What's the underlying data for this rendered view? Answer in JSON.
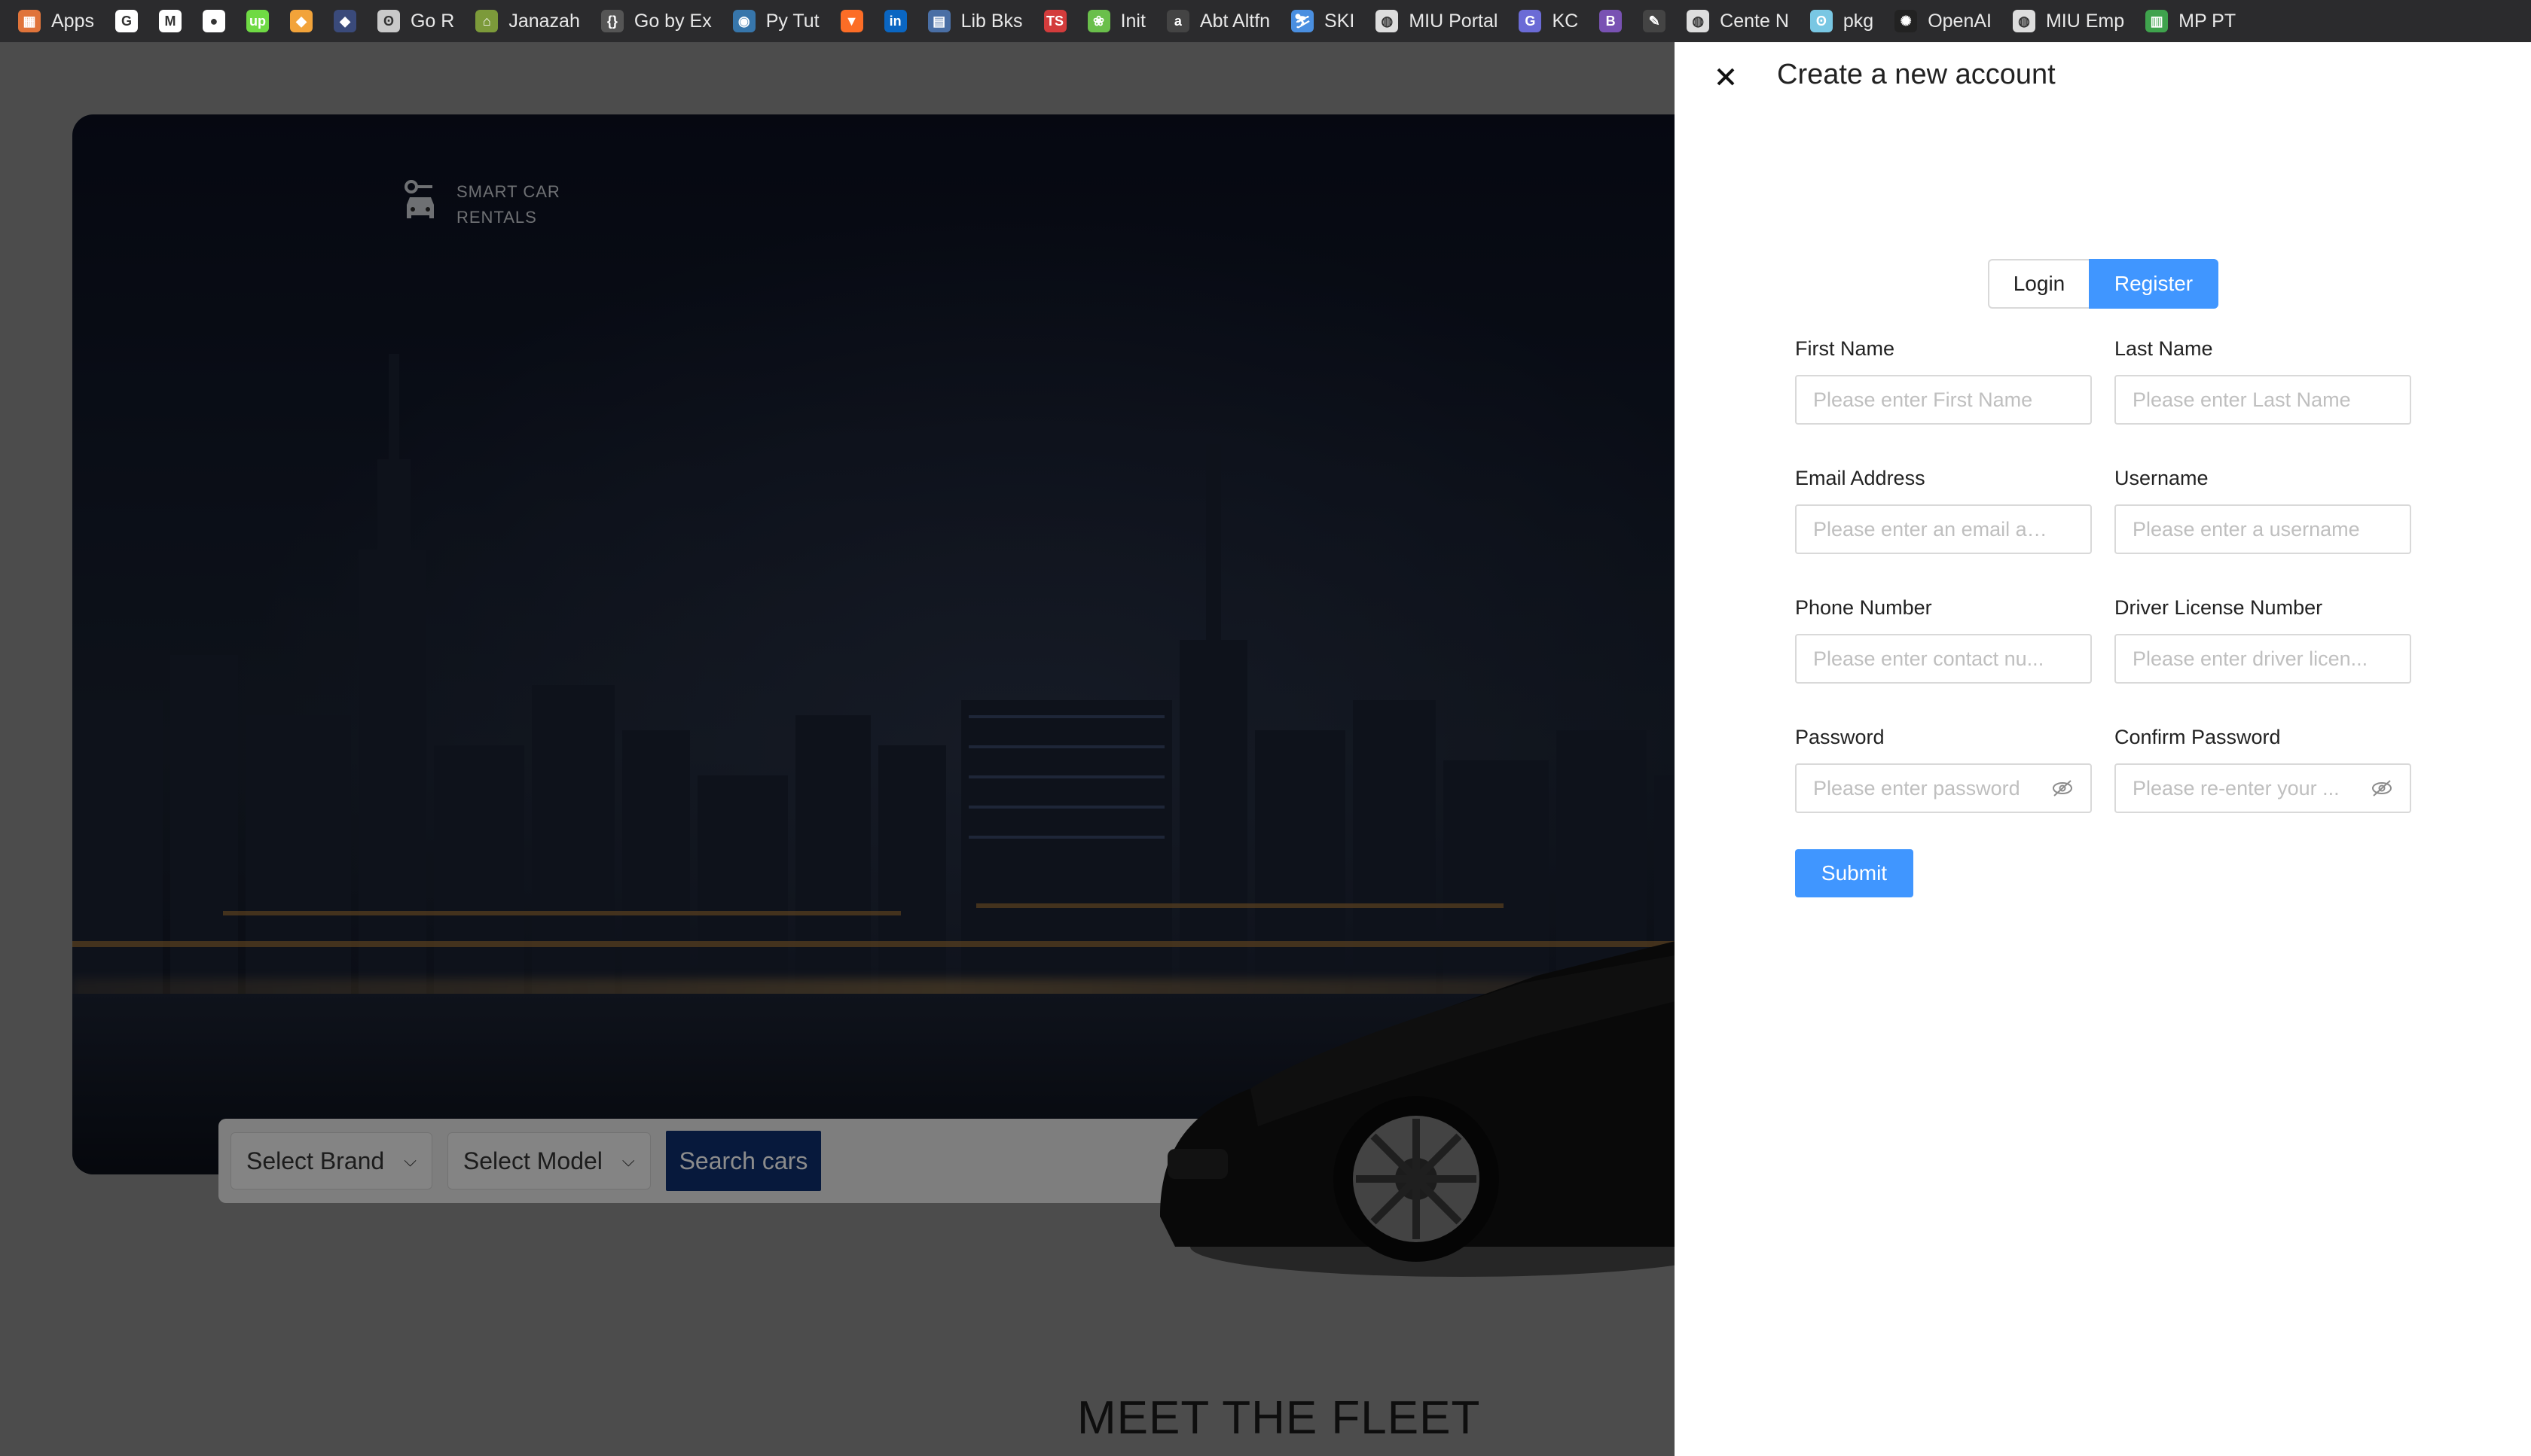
{
  "bookmarks": [
    {
      "label": "Apps",
      "icon": "apps-grid-icon",
      "color": "#e0743a"
    },
    {
      "label": "",
      "icon": "google-icon",
      "color": "#ffffff"
    },
    {
      "label": "",
      "icon": "gmail-icon",
      "color": "#ffffff"
    },
    {
      "label": "",
      "icon": "github-icon",
      "color": "#ffffff"
    },
    {
      "label": "",
      "icon": "upwork-icon",
      "color": "#6fda44"
    },
    {
      "label": "",
      "icon": "bookmark-icon",
      "color": "#f2a33a"
    },
    {
      "label": "",
      "icon": "bookmark-icon",
      "color": "#3a4a7a"
    },
    {
      "label": "Go R",
      "icon": "gopher-icon",
      "color": "#c9c9c9"
    },
    {
      "label": "Janazah",
      "icon": "mosque-icon",
      "color": "#7c9a3a"
    },
    {
      "label": "Go by Ex",
      "icon": "braces-icon",
      "color": "#555555"
    },
    {
      "label": "Py Tut",
      "icon": "python-icon",
      "color": "#3776ab"
    },
    {
      "label": "",
      "icon": "gitlab-icon",
      "color": "#fc6d26"
    },
    {
      "label": "",
      "icon": "linkedin-icon",
      "color": "#0a66c2"
    },
    {
      "label": "Lib Bks",
      "icon": "book-icon",
      "color": "#4a6fa5"
    },
    {
      "label": "",
      "icon": "ts-icon",
      "color": "#d33c3c"
    },
    {
      "label": "Init",
      "icon": "leaf-icon",
      "color": "#6abf4b"
    },
    {
      "label": "Abt Altfn",
      "icon": "a-icon",
      "color": "#444444"
    },
    {
      "label": "SKI",
      "icon": "ski-icon",
      "color": "#4a8fe0"
    },
    {
      "label": "MIU Portal",
      "icon": "globe-icon",
      "color": "#dddddd"
    },
    {
      "label": "KC",
      "icon": "g-icon",
      "color": "#6b6bd6"
    },
    {
      "label": "",
      "icon": "bootstrap-icon",
      "color": "#7952b3"
    },
    {
      "label": "",
      "icon": "feather-icon",
      "color": "#444444"
    },
    {
      "label": "Cente N",
      "icon": "globe-icon",
      "color": "#dddddd"
    },
    {
      "label": "pkg",
      "icon": "gopher-icon",
      "color": "#79c7e3"
    },
    {
      "label": "OpenAI",
      "icon": "openai-icon",
      "color": "#222222"
    },
    {
      "label": "MIU Emp",
      "icon": "globe-icon",
      "color": "#dddddd"
    },
    {
      "label": "MP PT",
      "icon": "chart-icon",
      "color": "#3fa34d"
    }
  ],
  "background": {
    "logo_line1": "SMART CAR",
    "logo_line2": "RENTALS",
    "brand_select": "Select Brand",
    "model_select": "Select Model",
    "search_button": "Search cars",
    "section_heading": "MEET THE FLEET"
  },
  "drawer": {
    "title": "Create a new account",
    "tabs": {
      "login": "Login",
      "register": "Register",
      "active": "Register"
    },
    "fields": {
      "first_name": {
        "label": "First Name",
        "placeholder": "Please enter First Name"
      },
      "last_name": {
        "label": "Last Name",
        "placeholder": "Please enter Last Name"
      },
      "email": {
        "label": "Email Address",
        "placeholder": "Please enter an email ad..."
      },
      "username": {
        "label": "Username",
        "placeholder": "Please enter a username"
      },
      "phone": {
        "label": "Phone Number",
        "placeholder": "Please enter contact nu..."
      },
      "license": {
        "label": "Driver License Number",
        "placeholder": "Please enter driver licen..."
      },
      "password": {
        "label": "Password",
        "placeholder": "Please enter password"
      },
      "confirm_password": {
        "label": "Confirm Password",
        "placeholder": "Please re-enter your ..."
      }
    },
    "submit": "Submit"
  },
  "colors": {
    "primary": "#4096ff",
    "search_button": "#0d2f6e",
    "bookmark_bar": "#2b2b2d"
  }
}
